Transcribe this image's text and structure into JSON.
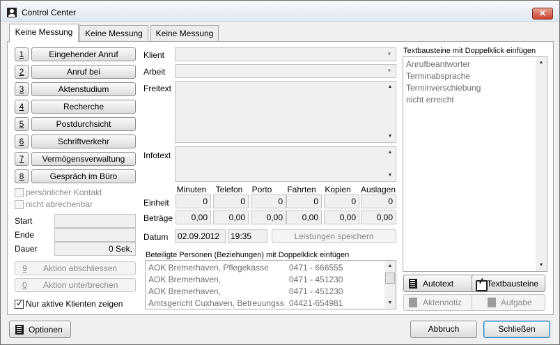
{
  "window": {
    "title": "Control Center",
    "close_label": "✕"
  },
  "tabs": [
    {
      "label": "Keine Messung"
    },
    {
      "label": "Keine Messung"
    },
    {
      "label": "Keine Messung"
    }
  ],
  "actions": [
    {
      "num": "1",
      "label": "Eingehender Anruf"
    },
    {
      "num": "2",
      "label": "Anruf bei"
    },
    {
      "num": "3",
      "label": "Aktenstudium"
    },
    {
      "num": "4",
      "label": "Recherche"
    },
    {
      "num": "5",
      "label": "Postdurchsicht"
    },
    {
      "num": "6",
      "label": "Schriftverkehr"
    },
    {
      "num": "7",
      "label": "Vermögensverwaltung"
    },
    {
      "num": "8",
      "label": "Gespräch im Büro"
    }
  ],
  "checks": {
    "personal": "persönlicher Kontakt",
    "nonbillable": "nicht abrechenbar",
    "active_only": "Nur aktive Klienten zeigen"
  },
  "timer": {
    "start_label": "Start",
    "end_label": "Ende",
    "duration_label": "Dauer",
    "duration_value": "0 Sek,"
  },
  "control_buttons": {
    "finish_num": "9",
    "finish_label": "Aktion abschliessen",
    "pause_num": "0",
    "pause_label": "Aktion unterbrechen"
  },
  "form": {
    "client_label": "Klient",
    "work_label": "Arbeit",
    "freetext_label": "Freitext",
    "infotext_label": "Infotext",
    "unit_label": "Einheit",
    "amount_label": "Beträge",
    "date_label": "Datum",
    "date_value": "02.09.2012",
    "time_value": "19:35",
    "save_label": "Leistungen speichern"
  },
  "grid": {
    "columns": [
      "Minuten",
      "Telefon",
      "Porto",
      "Fahrten",
      "Kopien",
      "Auslagen"
    ],
    "units": [
      "0",
      "0",
      "0",
      "0",
      "0",
      "0"
    ],
    "amounts": [
      "0,00",
      "0,00",
      "0,00",
      "0,00",
      "0,00",
      "0,00"
    ]
  },
  "persons": {
    "caption": "Beteiligte Personen (Beziehungen) mit Doppelklick einfügen",
    "rows": [
      {
        "name": "AOK Bremerhaven, Pflegekasse",
        "phone": "0471 - 666555"
      },
      {
        "name": "AOK Bremerhaven,",
        "phone": "0471 - 451230"
      },
      {
        "name": "AOK Bremerhaven,",
        "phone": "0471 - 451230"
      },
      {
        "name": "Amtsgericht Cuxhaven, Betreuungss",
        "phone": "04421-654981"
      }
    ]
  },
  "textblocks": {
    "caption": "Textbausteine mit Doppelklick einfügen",
    "items": [
      "Anrufbeantworter",
      "Terminabsprache",
      "Terminverschiebung",
      "nicht erreicht"
    ]
  },
  "right_buttons": {
    "autotext": "Autotext",
    "textbausteine": "Textbausteine",
    "aktennotiz": "Aktennotiz",
    "aufgabe": "Aufgabe"
  },
  "footer": {
    "options": "Optionen",
    "cancel": "Abbruch",
    "close": "Schließen"
  }
}
